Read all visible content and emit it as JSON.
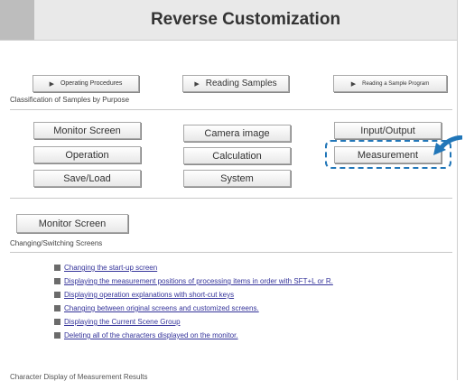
{
  "header": {
    "title": "Reverse Customization"
  },
  "nav_buttons": [
    {
      "label": "Operating Procedures"
    },
    {
      "label": "Reading Samples"
    },
    {
      "label": "Reading a Sample Program"
    }
  ],
  "classification_label": "Classification of Samples by Purpose",
  "category_buttons": [
    {
      "label": "Monitor Screen"
    },
    {
      "label": "Camera image"
    },
    {
      "label": "Input/Output"
    },
    {
      "label": "Operation"
    },
    {
      "label": "Calculation"
    },
    {
      "label": "Measurement"
    },
    {
      "label": "Save/Load"
    },
    {
      "label": "System"
    }
  ],
  "section": {
    "button_label": "Monitor Screen",
    "subheading": "Changing/Switching Screens"
  },
  "links": [
    "Changing the start-up screen",
    "Displaying the measurement positions of processing items in order with SFT+L or R.",
    "Displaying operation explanations with short-cut keys",
    "Changing between original screens and customized screens.",
    "Displaying the Current Scene Group",
    "Deleting all of the characters displayed on the monitor."
  ],
  "cut_off_text": "Character Display of Measurement Results",
  "colors": {
    "highlight": "#2176b8",
    "link": "#34339a",
    "header_bg": "#e9e9e9",
    "header_block": "#bdbdbd"
  },
  "icons": {
    "nav_button_icon": "play-triangle",
    "list_bullet_icon": "square-bullet",
    "callout_arrow": "curved-arrow"
  }
}
